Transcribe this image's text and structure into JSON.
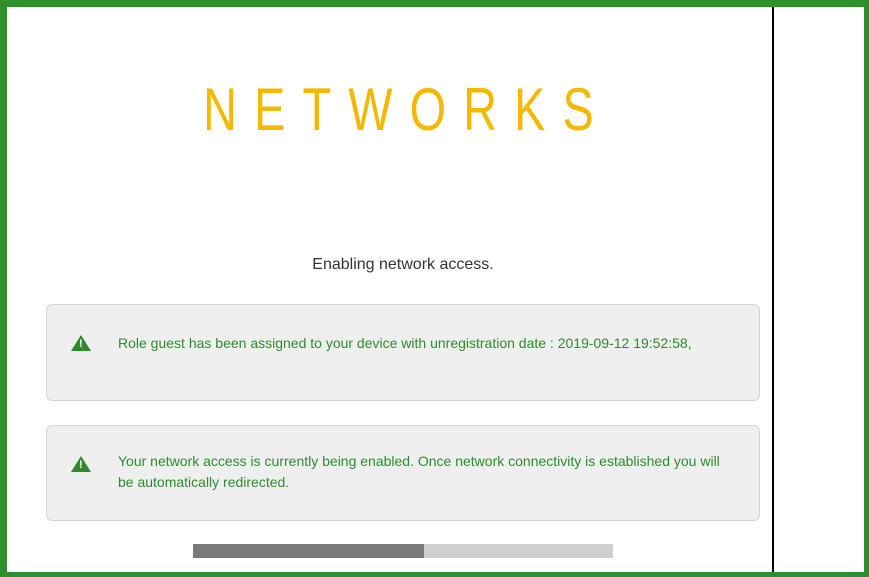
{
  "logo": {
    "text": "NETWORKS"
  },
  "status_text": "Enabling network access.",
  "alerts": [
    {
      "icon": "warning-triangle-icon",
      "message": "Role guest has been assigned to your device with unregistration date : 2019-09-12 19:52:58,"
    },
    {
      "icon": "warning-triangle-icon",
      "message": "Your network access is currently being enabled. Once network connectivity is established you will be automatically redirected."
    }
  ],
  "progress": {
    "fraction": 0.55
  },
  "colors": {
    "frame": "#2f8f2c",
    "logo": "#f5b800",
    "alert_text": "#2e8b2e",
    "progress_fill": "#7a7a7a",
    "progress_track": "#cfcfcf"
  }
}
